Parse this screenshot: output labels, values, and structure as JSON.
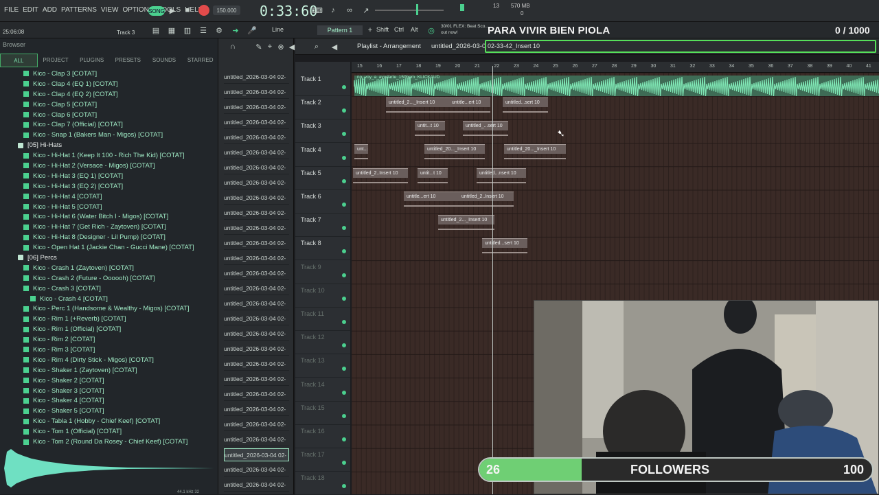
{
  "menu": [
    "FILE",
    "EDIT",
    "ADD",
    "PATTERNS",
    "VIEW",
    "OPTIONS",
    "TOOLS",
    "HELP"
  ],
  "transport": {
    "tempo": "150.000",
    "time": "0:33:60",
    "cpu": "13",
    "mem": "570 MB",
    "mem2": "0",
    "song_pos": "25:06:08",
    "track_label": "Track 3",
    "snap": "Line",
    "pattern": "Pattern 1",
    "modifiers": [
      "Shift",
      "Ctrl",
      "Alt"
    ],
    "news": "30/01 FLEX: Beat Sco...",
    "news2": "out now!"
  },
  "browser": {
    "title": "Browser",
    "tabs": [
      "ALL",
      "PROJECT",
      "PLUGINS",
      "PRESETS",
      "SOUNDS",
      "STARRED"
    ],
    "items": [
      {
        "label": "Kico - Clap 3 [COTAT]",
        "type": "file"
      },
      {
        "label": "Kico - Clap 4 (EQ 1) [COTAT]",
        "type": "file"
      },
      {
        "label": "Kico - Clap 4 (EQ 2) [COTAT]",
        "type": "file"
      },
      {
        "label": "Kico - Clap 5 [COTAT]",
        "type": "file"
      },
      {
        "label": "Kico - Clap 6 [COTAT]",
        "type": "file"
      },
      {
        "label": "Kico - Clap 7 (Official) [COTAT]",
        "type": "file"
      },
      {
        "label": "Kico - Snap 1 (Bakers Man - Migos) [COTAT]",
        "type": "file"
      },
      {
        "label": "[05] Hi-Hats",
        "type": "folder"
      },
      {
        "label": "Kico - Hi-Hat 1 (Keep It 100 - Rich The Kid) [COTAT]",
        "type": "file"
      },
      {
        "label": "Kico - Hi-Hat 2 (Versace - Migos) [COTAT]",
        "type": "file"
      },
      {
        "label": "Kico - Hi-Hat 3 (EQ 1) [COTAT]",
        "type": "file"
      },
      {
        "label": "Kico - Hi-Hat 3 (EQ 2) [COTAT]",
        "type": "file"
      },
      {
        "label": "Kico - Hi-Hat 4 [COTAT]",
        "type": "file"
      },
      {
        "label": "Kico - Hi-Hat 5 [COTAT]",
        "type": "file"
      },
      {
        "label": "Kico - Hi-Hat 6 (Water Bitch I - Migos) [COTAT]",
        "type": "file"
      },
      {
        "label": "Kico - Hi-Hat 7 (Get Rich - Zaytoven) [COTAT]",
        "type": "file"
      },
      {
        "label": "Kico - Hi-Hat 8 (Designer - Lil Pump) [COTAT]",
        "type": "file"
      },
      {
        "label": "Kico - Open Hat 1 (Jackie Chan - Gucci Mane) [COTAT]",
        "type": "file"
      },
      {
        "label": "[06] Percs",
        "type": "folder"
      },
      {
        "label": "Kico - Crash 1 (Zaytoven) [COTAT]",
        "type": "file"
      },
      {
        "label": "Kico - Crash 2 (Future - Oooooh) [COTAT]",
        "type": "file"
      },
      {
        "label": "Kico - Crash 3 [COTAT]",
        "type": "file"
      },
      {
        "label": "Kico - Crash 4 [COTAT]",
        "type": "selected"
      },
      {
        "label": "Kico - Perc 1 (Handsome & Wealthy - Migos) [COTAT]",
        "type": "file"
      },
      {
        "label": "Kico - Rim 1 (+Reverb) [COTAT]",
        "type": "file"
      },
      {
        "label": "Kico - Rim 1 (Official) [COTAT]",
        "type": "file"
      },
      {
        "label": "Kico - Rim 2 [COTAT]",
        "type": "file"
      },
      {
        "label": "Kico - Rim 3 [COTAT]",
        "type": "file"
      },
      {
        "label": "Kico - Rim 4 (Dirty Stick - Migos) [COTAT]",
        "type": "file"
      },
      {
        "label": "Kico - Shaker 1 (Zaytoven) [COTAT]",
        "type": "file"
      },
      {
        "label": "Kico - Shaker 2 [COTAT]",
        "type": "file"
      },
      {
        "label": "Kico - Shaker 3 [COTAT]",
        "type": "file"
      },
      {
        "label": "Kico - Shaker 4 [COTAT]",
        "type": "file"
      },
      {
        "label": "Kico - Shaker 5 [COTAT]",
        "type": "file"
      },
      {
        "label": "Kico - Tabla 1 (Hobby - Chief Keef) [COTAT]",
        "type": "file"
      },
      {
        "label": "Kico - Tom 1 (Official) [COTAT]",
        "type": "file"
      },
      {
        "label": "Kico - Tom 2 (Round Da Rosey - Chief Keef) [COTAT]",
        "type": "file"
      }
    ],
    "sample_info": "44.1 kHz 32"
  },
  "pattern_list": {
    "item": "untitled_2026-03-04 02-",
    "count": 28,
    "selected_index": 25
  },
  "playlist": {
    "title": "Playlist - Arrangement",
    "project": "untitled_2026-03-04 02-33-42_Insert 10",
    "ruler": [
      "15",
      "16",
      "17",
      "18",
      "19",
      "20",
      "21",
      "22",
      "23",
      "24",
      "25",
      "26",
      "27",
      "28",
      "29",
      "30",
      "31",
      "32",
      "33",
      "34",
      "35",
      "36",
      "37",
      "38",
      "39",
      "40",
      "41"
    ],
    "tracks": [
      "Track 1",
      "Track 2",
      "Track 3",
      "Track 4",
      "Track 5",
      "Track 6",
      "Track 7",
      "Track 8",
      "Track 9",
      "Track 10",
      "Track 11",
      "Track 12",
      "Track 13",
      "Track 14",
      "Track 15",
      "Track 16",
      "Track 17",
      "Track 18"
    ],
    "audio_clip": "no_voy_a_ayudarte_150bpm_KLICKAUD",
    "clips": [
      {
        "t": 1,
        "label": "untitled_2..._Insert 10"
      },
      {
        "t": 1,
        "label": "untitle...ert 10"
      },
      {
        "t": 1,
        "label": "untitled...sert 10"
      },
      {
        "t": 2,
        "label": "untit...t 10"
      },
      {
        "t": 2,
        "label": "untitled_...sert 10"
      },
      {
        "t": 3,
        "label": "unt...0"
      },
      {
        "t": 3,
        "label": "untitled_20..._Insert 10"
      },
      {
        "t": 3,
        "label": "untitled_20..._Insert 10"
      },
      {
        "t": 4,
        "label": "untitled_2..Insert 10"
      },
      {
        "t": 4,
        "label": "untit...t 10"
      },
      {
        "t": 4,
        "label": "untitled...nsert 10"
      },
      {
        "t": 5,
        "label": "untitle...ert 10"
      },
      {
        "t": 5,
        "label": "untitled_2..Insert 10"
      },
      {
        "t": 6,
        "label": "untitled_2..._Insert 10"
      },
      {
        "t": 7,
        "label": "untitled...sert 10"
      }
    ]
  },
  "overlay": {
    "title": "PARA VIVIR BIEN PIOLA",
    "counter": "0  / 1000",
    "followers_current": "26",
    "followers_label": "FOLLOWERS",
    "followers_goal": "100",
    "followers_progress": 0.26
  },
  "colors": {
    "accent": "#4bd08f",
    "bar": "#56e05a",
    "clip": "#6a5e5c",
    "grid": "#3a2a26"
  }
}
